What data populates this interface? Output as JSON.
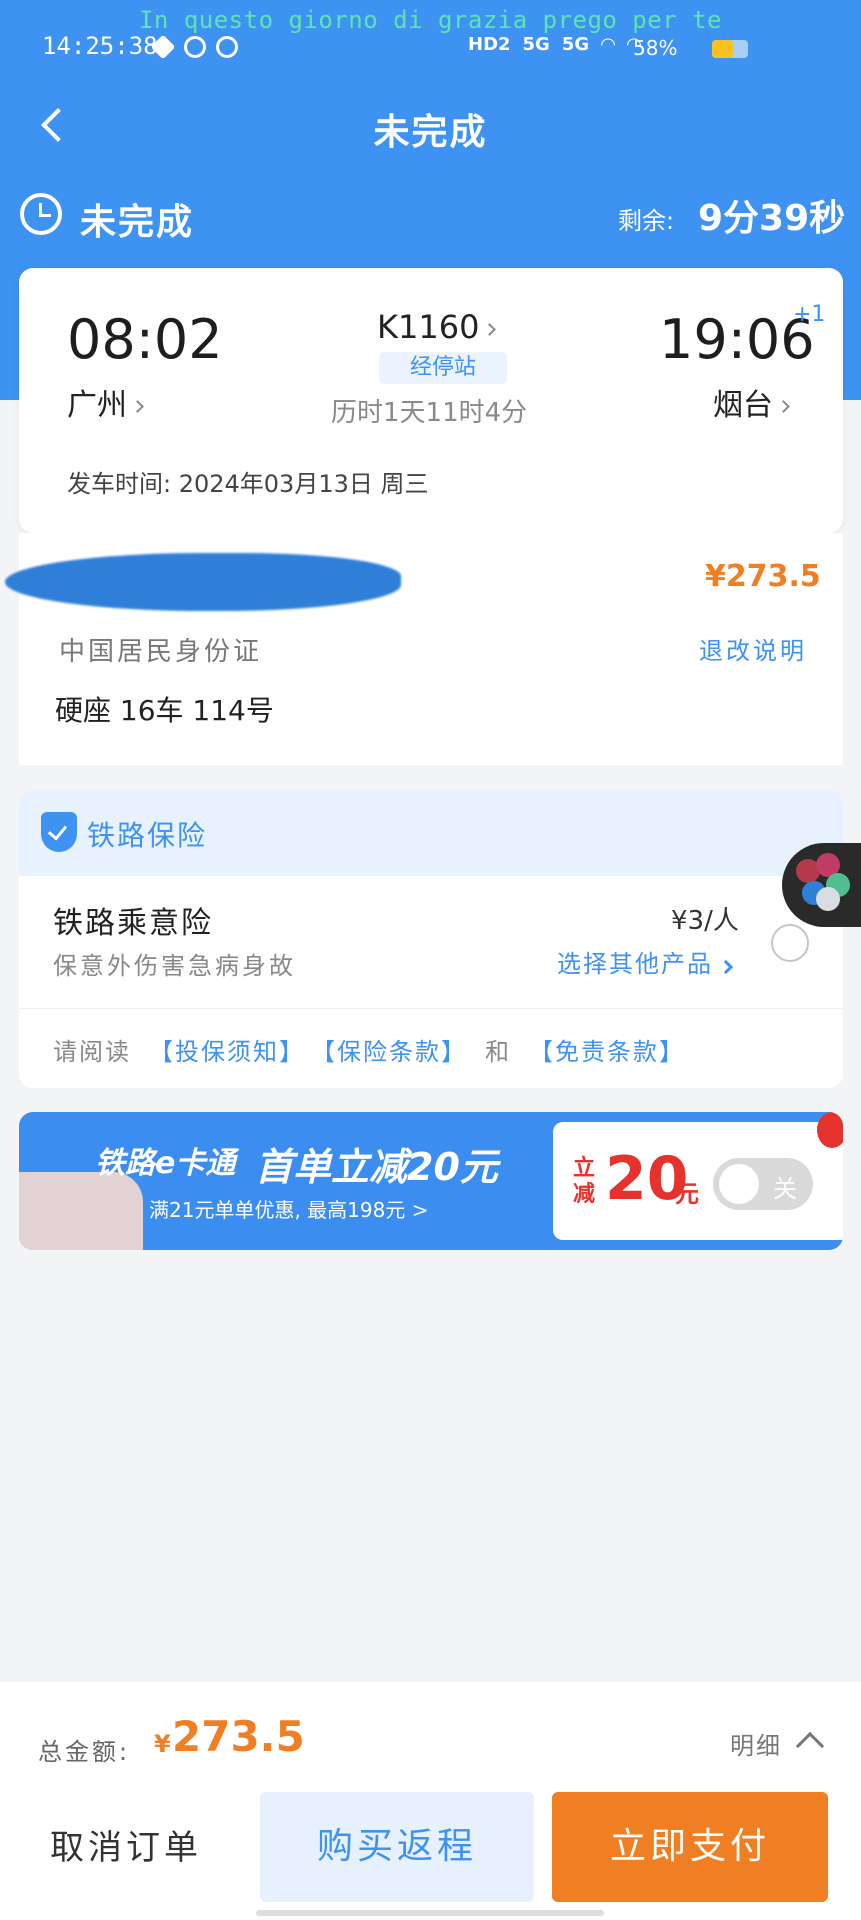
{
  "status_bar": {
    "watermark": "In questo giorno di grazia prego per te",
    "time": "14:25:38",
    "network": [
      "HD2",
      "5G",
      "5G"
    ],
    "battery_text": "58%",
    "battery_level": 0.58
  },
  "nav": {
    "title": "未完成"
  },
  "order_status": {
    "label": "未完成",
    "remaining_label": "剩余:",
    "remaining_value": "9分39秒"
  },
  "train": {
    "departure_time": "08:02",
    "departure_city": "广州",
    "train_number": "K1160",
    "stops_label": "经停站",
    "duration": "历时1天11时4分",
    "arrival_time": "19:06",
    "arrival_day_offset": "+1",
    "arrival_city": "烟台",
    "departure_date": "发车时间: 2024年03月13日 周三"
  },
  "passenger": {
    "name": "",
    "price": "¥273.5",
    "id_type": "中国居民身份证",
    "refund_link": "退改说明",
    "seat": "硬座  16车  114号"
  },
  "insurance": {
    "section_title": "铁路保险",
    "product_name": "铁路乘意险",
    "product_desc": "保意外伤害急病身故",
    "price": "¥3/人",
    "other_products": "选择其他产品",
    "terms_prefix": "请阅读",
    "terms_notice": "【投保须知】",
    "terms_clauses": "【保险条款】",
    "terms_and": "和",
    "terms_disclaimer": "【免责条款】"
  },
  "banner": {
    "brand": "铁路e卡通",
    "headline": "首单立减20元",
    "subtitle": "满21元单单优惠, 最高198元 >",
    "coupon_prefix": "立减",
    "coupon_amount": "20",
    "coupon_unit": "元",
    "toggle_label": "关"
  },
  "bottom": {
    "total_label": "总金额:",
    "total_currency": "¥",
    "total_amount": "273.5",
    "detail_label": "明细",
    "cancel_label": "取消订单",
    "return_label": "购买返程",
    "pay_label": "立即支付"
  },
  "colors": {
    "primary_blue": "#3d92f2",
    "accent_orange": "#f07f23",
    "coupon_red": "#e5322d"
  }
}
